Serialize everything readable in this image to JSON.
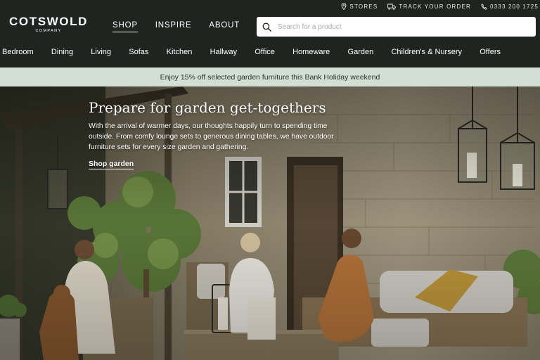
{
  "utility": {
    "stores": "STORES",
    "track": "TRACK YOUR ORDER",
    "phone": "0333 200 1725"
  },
  "logo": {
    "brand": "COTSWOLD",
    "sub": "COMPANY"
  },
  "main_nav": {
    "items": [
      "SHOP",
      "INSPIRE",
      "ABOUT"
    ],
    "active": "SHOP"
  },
  "search": {
    "placeholder": "Search for a product",
    "value": ""
  },
  "category_nav": {
    "items": [
      "Bedroom",
      "Dining",
      "Living",
      "Sofas",
      "Kitchen",
      "Hallway",
      "Office",
      "Homeware",
      "Garden",
      "Children's & Nursery",
      "Offers"
    ]
  },
  "promo": {
    "text": "Enjoy 15% off selected garden furniture this Bank Holiday weekend"
  },
  "hero": {
    "title": "Prepare for garden get-togethers",
    "body": "With the arrival of warmer days, our thoughts happily turn to spending time outside. From comfy lounge sets to generous dining tables, we have outdoor furniture sets for every size garden and gathering.",
    "cta": "Shop garden"
  },
  "colors": {
    "header_bg": "#1f2421",
    "promo_bg": "#d3dfd4",
    "search_bg": "#ffffff",
    "text_light": "#ffffff"
  },
  "icons": {
    "stores": "map-pin-icon",
    "track": "truck-icon",
    "phone": "phone-icon",
    "search": "search-icon"
  }
}
